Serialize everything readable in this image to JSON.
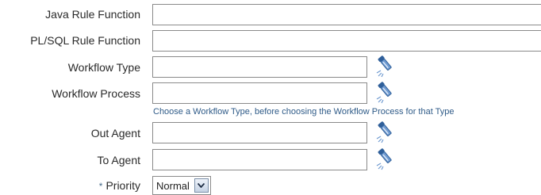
{
  "fields": {
    "java_rule_function": {
      "label": "Java Rule Function",
      "value": ""
    },
    "plsql_rule_function": {
      "label": "PL/SQL Rule Function",
      "value": ""
    },
    "workflow_type": {
      "label": "Workflow Type",
      "value": ""
    },
    "workflow_process": {
      "label": "Workflow Process",
      "value": "",
      "hint": "Choose a Workflow Type, before choosing the Workflow Process for that Type"
    },
    "out_agent": {
      "label": "Out Agent",
      "value": ""
    },
    "to_agent": {
      "label": "To Agent",
      "value": ""
    },
    "priority": {
      "label": "Priority",
      "required_marker": "*",
      "selected": "Normal"
    }
  },
  "icons": {
    "lov": "flashlight-search-icon",
    "dropdown": "chevron-down-icon"
  },
  "colors": {
    "hint_text": "#2f5b88",
    "required_marker": "#4a6d8c",
    "icon_blue": "#3a6fb0"
  }
}
